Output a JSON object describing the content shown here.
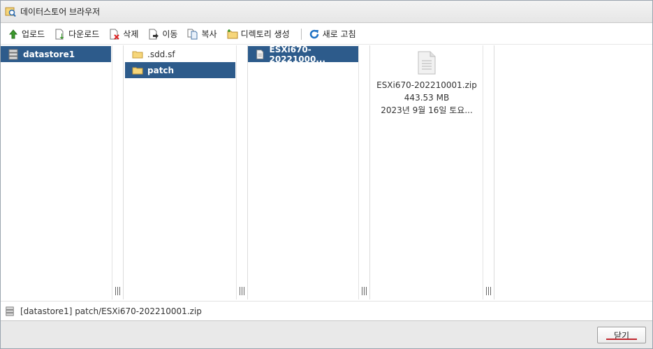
{
  "window": {
    "title": "데이터스토어 브라우저"
  },
  "toolbar": {
    "upload": "업로드",
    "download": "다운로드",
    "delete": "삭제",
    "move": "이동",
    "copy": "복사",
    "mkdir": "디렉토리 생성",
    "refresh": "새로 고침"
  },
  "columns": {
    "col1": {
      "items": [
        {
          "label": "datastore1",
          "selected": true,
          "icon": "datastore-icon"
        }
      ]
    },
    "col2": {
      "items": [
        {
          "label": ".sdd.sf",
          "selected": false,
          "icon": "folder-icon"
        },
        {
          "label": "patch",
          "selected": true,
          "icon": "folder-icon"
        }
      ]
    },
    "col3": {
      "items": [
        {
          "label": "ESXi670-20221000...",
          "selected": true,
          "icon": "file-icon"
        }
      ]
    },
    "preview": {
      "name": "ESXi670-202210001.zip",
      "size": "443.53 MB",
      "date": "2023년 9월 16일 토요..."
    }
  },
  "status": {
    "path": "[datastore1] patch/ESXi670-202210001.zip"
  },
  "footer": {
    "close_label": "닫기"
  },
  "colors": {
    "selection": "#2d5b8b",
    "accent_underline": "#c0262d"
  }
}
